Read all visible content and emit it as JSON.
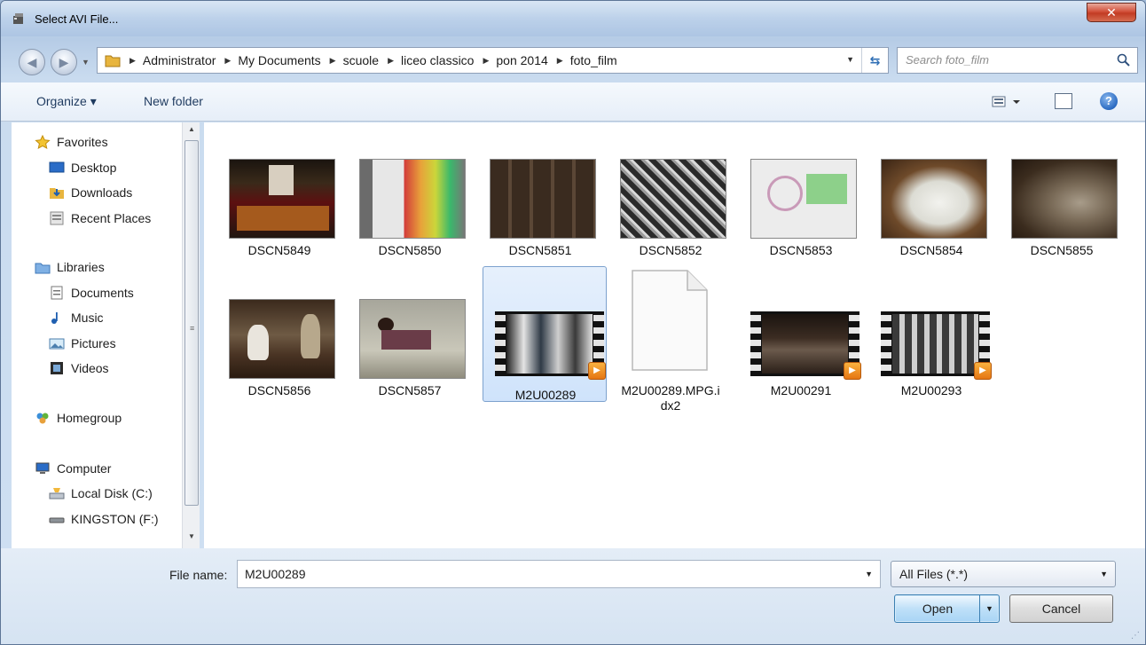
{
  "window": {
    "title": "Select AVI File...",
    "close_label": "✕"
  },
  "address": {
    "crumbs": [
      "Administrator",
      "My Documents",
      "scuole",
      "liceo classico",
      "pon 2014",
      "foto_film"
    ]
  },
  "search": {
    "placeholder": "Search foto_film"
  },
  "toolbar": {
    "organize": "Organize ▾",
    "new_folder": "New folder",
    "help": "?"
  },
  "sidebar": {
    "favorites": "Favorites",
    "desktop": "Desktop",
    "downloads": "Downloads",
    "recent": "Recent Places",
    "libraries": "Libraries",
    "documents": "Documents",
    "music": "Music",
    "pictures": "Pictures",
    "videos": "Videos",
    "homegroup": "Homegroup",
    "computer": "Computer",
    "local_disk": "Local Disk (C:)",
    "kingston": "KINGSTON (F:)"
  },
  "files": [
    {
      "name": "DSCN5849",
      "kind": "photo"
    },
    {
      "name": "DSCN5850",
      "kind": "photo"
    },
    {
      "name": "DSCN5851",
      "kind": "photo"
    },
    {
      "name": "DSCN5852",
      "kind": "photo"
    },
    {
      "name": "DSCN5853",
      "kind": "photo"
    },
    {
      "name": "DSCN5854",
      "kind": "photo"
    },
    {
      "name": "DSCN5855",
      "kind": "photo"
    },
    {
      "name": "DSCN5856",
      "kind": "photo"
    },
    {
      "name": "DSCN5857",
      "kind": "photo"
    },
    {
      "name": "M2U00289",
      "kind": "video",
      "selected": true
    },
    {
      "name": "M2U00289.MPG.i\ndx2",
      "kind": "document"
    },
    {
      "name": "M2U00291",
      "kind": "video"
    },
    {
      "name": "M2U00293",
      "kind": "video"
    }
  ],
  "footer": {
    "file_name_label": "File name:",
    "file_name_value": "M2U00289",
    "filter": "All Files (*.*)",
    "open": "Open",
    "cancel": "Cancel"
  },
  "colors": {
    "selection": "#cfe3fb",
    "accent": "#3c7fb1",
    "close": "#c23b23"
  }
}
